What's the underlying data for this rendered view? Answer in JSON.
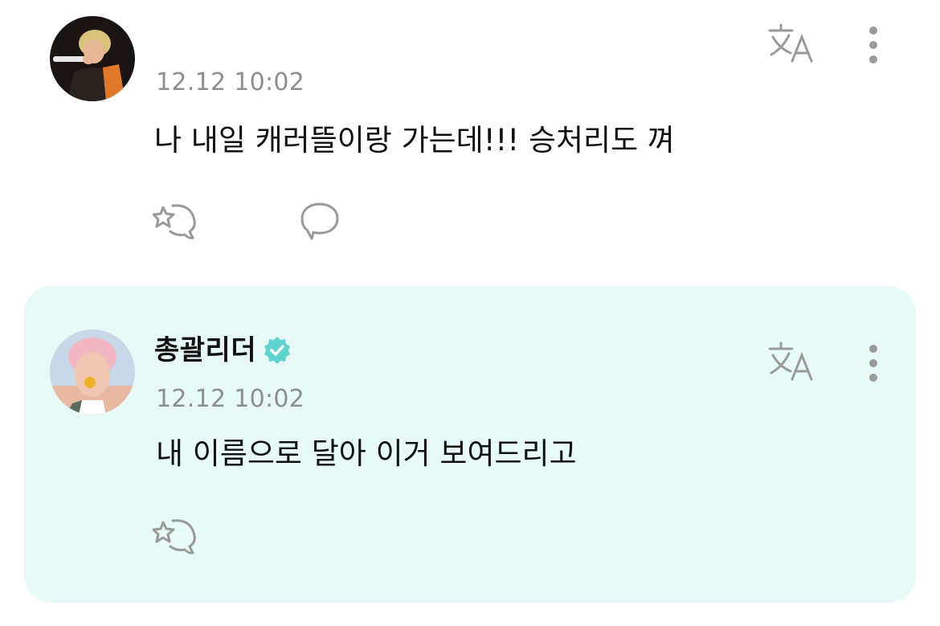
{
  "post": {
    "time": "12.12 10:02",
    "text": "나 내일 캐러뜰이랑 가는데!!! 승처리도 껴",
    "icons": {
      "avatar": "user-avatar",
      "translate": "translate-icon",
      "more": "more-vertical-icon",
      "like": "like-icon",
      "comment": "comment-icon"
    }
  },
  "reply": {
    "author": "총괄리더",
    "time": "12.12 10:02",
    "text": "내 이름으로 달아 이거 보여드리고",
    "icons": {
      "avatar": "artist-avatar",
      "verified": "verified-badge-icon",
      "translate": "translate-icon",
      "more": "more-vertical-icon",
      "like": "like-icon"
    }
  },
  "colors": {
    "reply_background": "#e8faf7",
    "verified": "#5fd3cd",
    "timestamp": "#8e8e8e",
    "icon": "#9a9a9a"
  }
}
